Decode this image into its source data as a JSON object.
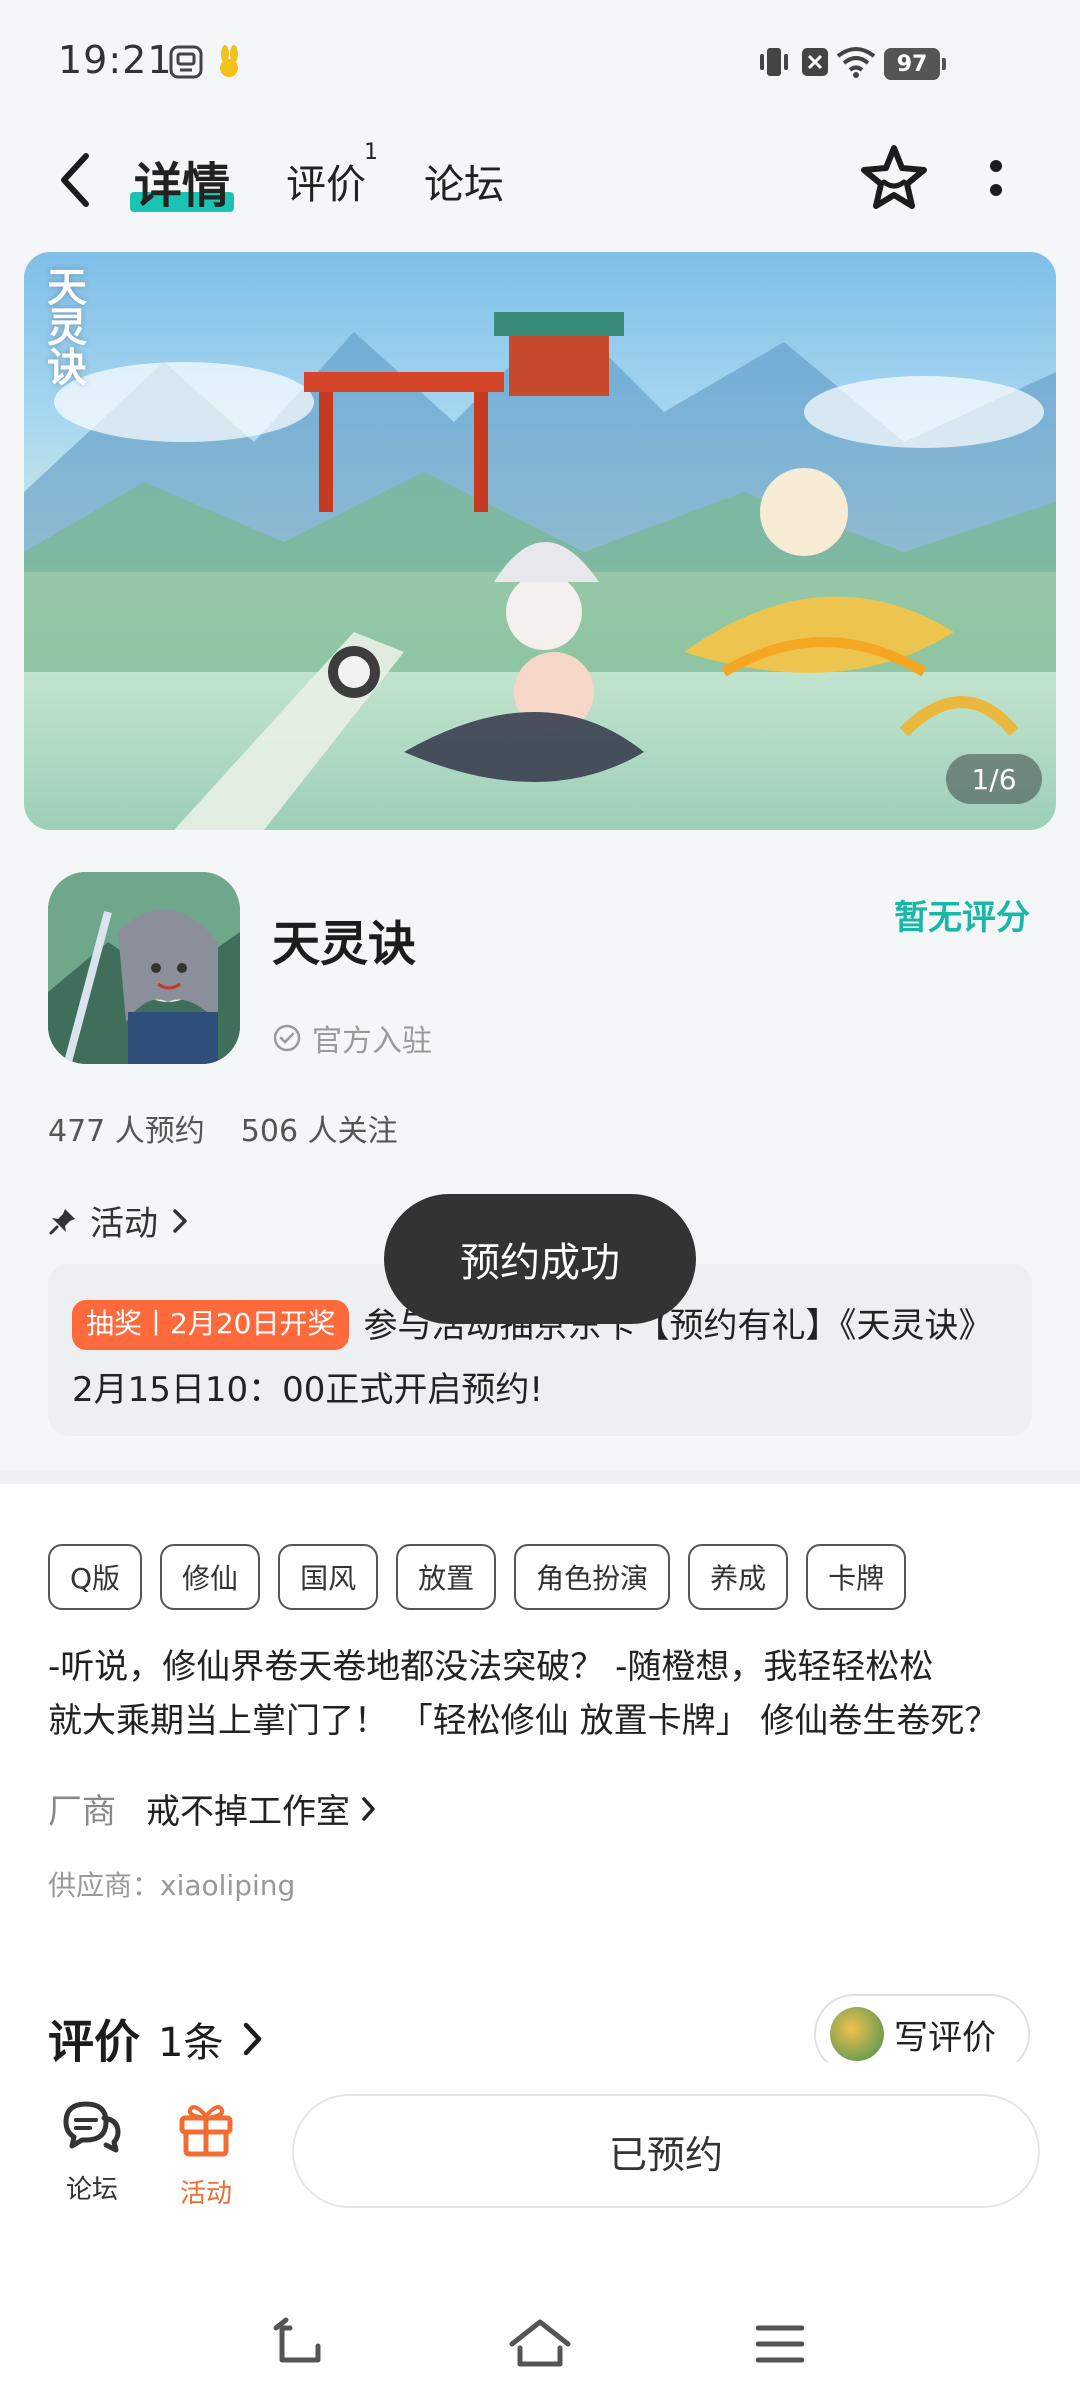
{
  "status_bar": {
    "time": "19:21",
    "battery": "97"
  },
  "nav": {
    "tabs": [
      {
        "label": "详情",
        "active": true
      },
      {
        "label": "评价",
        "badge": "1"
      },
      {
        "label": "论坛"
      }
    ],
    "accent_color": "#19c4b3"
  },
  "banner": {
    "logo_text": "天灵诀",
    "counter": "1/6"
  },
  "app": {
    "name": "天灵诀",
    "official_label": "官方入驻",
    "rating_text": "暂无评分",
    "reservations": "477 人预约",
    "followers": "506 人关注"
  },
  "activity": {
    "title": "活动",
    "badge": "抽奖丨2月20日开奖",
    "text": "参与活动抽京东卡【预约有礼】《天灵诀》2月15日10：00正式开启预约!",
    "badge_color": "#ff6a3d"
  },
  "toast": "预约成功",
  "tags": [
    "Q版",
    "修仙",
    "国风",
    "放置",
    "角色扮演",
    "养成",
    "卡牌"
  ],
  "description": {
    "line1": "-听说，修仙界卷天卷地都没法突破？ -随橙想，我轻轻松松",
    "line2": "就大乘期当上掌门了！ 「轻松修仙 放置卡牌」 修仙卷生卷死？"
  },
  "vendor": {
    "label": "厂商",
    "name": "戒不掉工作室"
  },
  "supplier": "供应商：xiaoliping",
  "reviews": {
    "title": "评价",
    "count": "1条",
    "write_label": "写评价"
  },
  "bottom_bar": {
    "forum_label": "论坛",
    "activity_label": "活动",
    "reserve_label": "已预约",
    "activity_color": "#f36c32"
  }
}
